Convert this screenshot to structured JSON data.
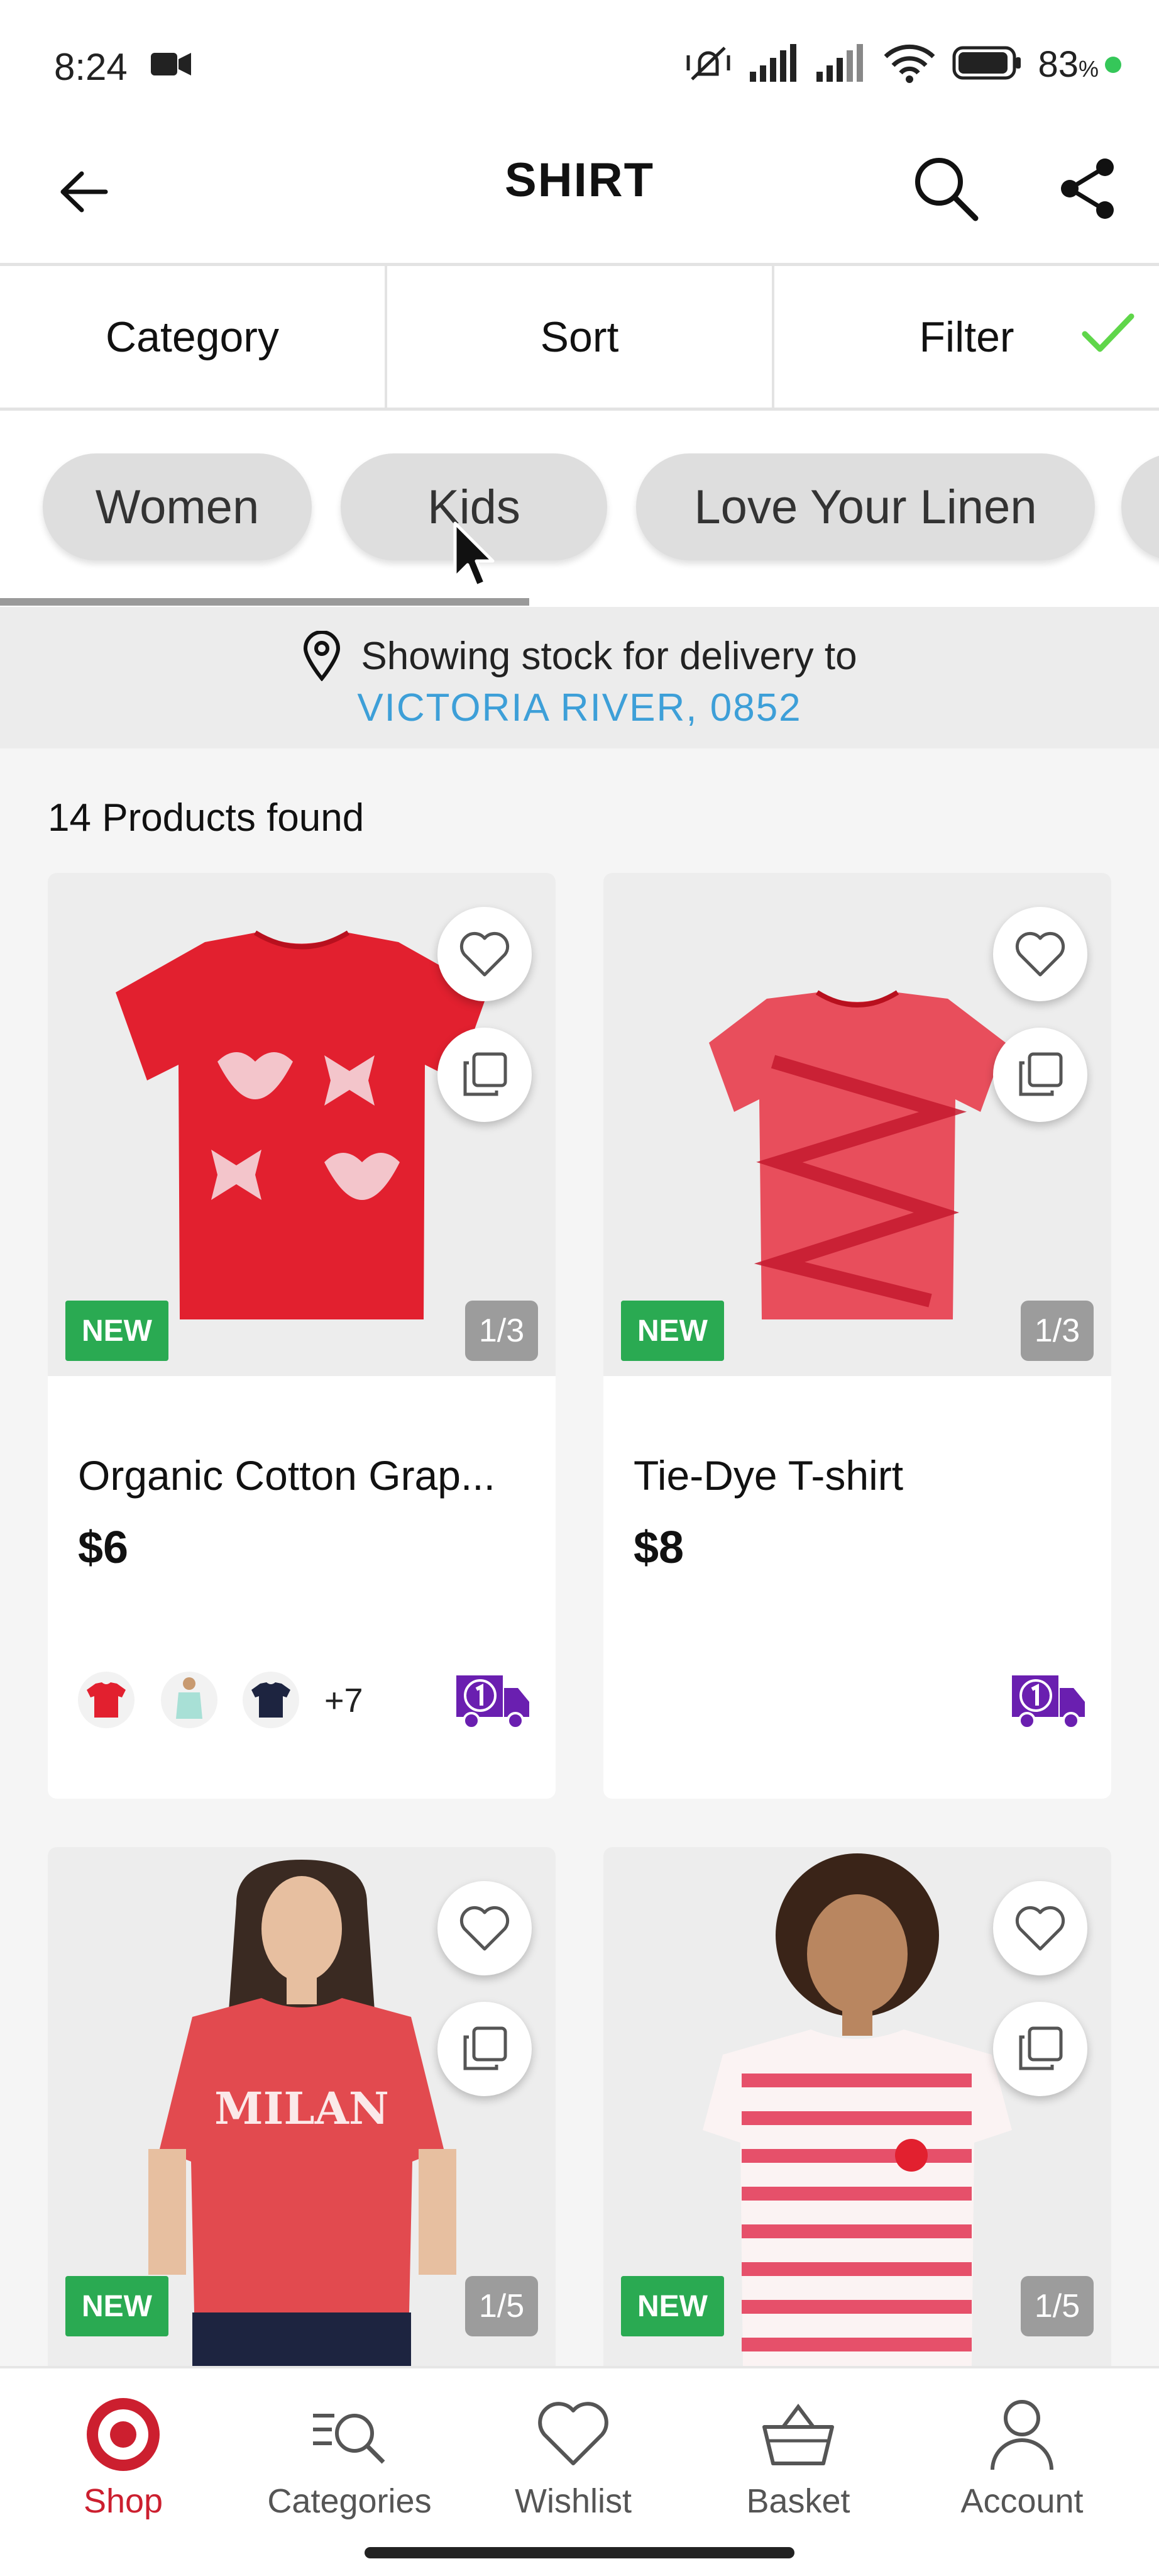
{
  "status_bar": {
    "time": "8:24",
    "battery": "83",
    "battery_unit": "%"
  },
  "header": {
    "title": "SHIRT"
  },
  "tabs": [
    {
      "label": "Category"
    },
    {
      "label": "Sort"
    },
    {
      "label": "Filter"
    }
  ],
  "chips": [
    {
      "label": "Women"
    },
    {
      "label": "Kids"
    },
    {
      "label": "Love Your Linen"
    }
  ],
  "delivery": {
    "line1": "Showing stock for delivery to",
    "location": "VICTORIA RIVER, 0852"
  },
  "results": {
    "count_text": "14 Products found"
  },
  "products": [
    {
      "badge": "NEW",
      "counter": "1/3",
      "name": "Organic Cotton Grap...",
      "price": "$6",
      "more_colors": "+7"
    },
    {
      "badge": "NEW",
      "counter": "1/3",
      "name": "Tie-Dye T-shirt",
      "price": "$8"
    },
    {
      "badge": "NEW",
      "counter": "1/5",
      "shirt_text": "MILAN"
    },
    {
      "badge": "NEW",
      "counter": "1/5"
    }
  ],
  "bottom_nav": [
    {
      "label": "Shop",
      "icon": "target-logo-icon",
      "active": true
    },
    {
      "label": "Categories",
      "icon": "categories-search-icon"
    },
    {
      "label": "Wishlist",
      "icon": "heart-icon"
    },
    {
      "label": "Basket",
      "icon": "basket-icon"
    },
    {
      "label": "Account",
      "icon": "user-icon"
    }
  ],
  "colors": {
    "brand_red": "#cc1f2f",
    "link_blue": "#3d9fd8",
    "badge_green": "#2aaa52",
    "check_green": "#5fd64a",
    "delivery_purple": "#6a1fb0"
  }
}
